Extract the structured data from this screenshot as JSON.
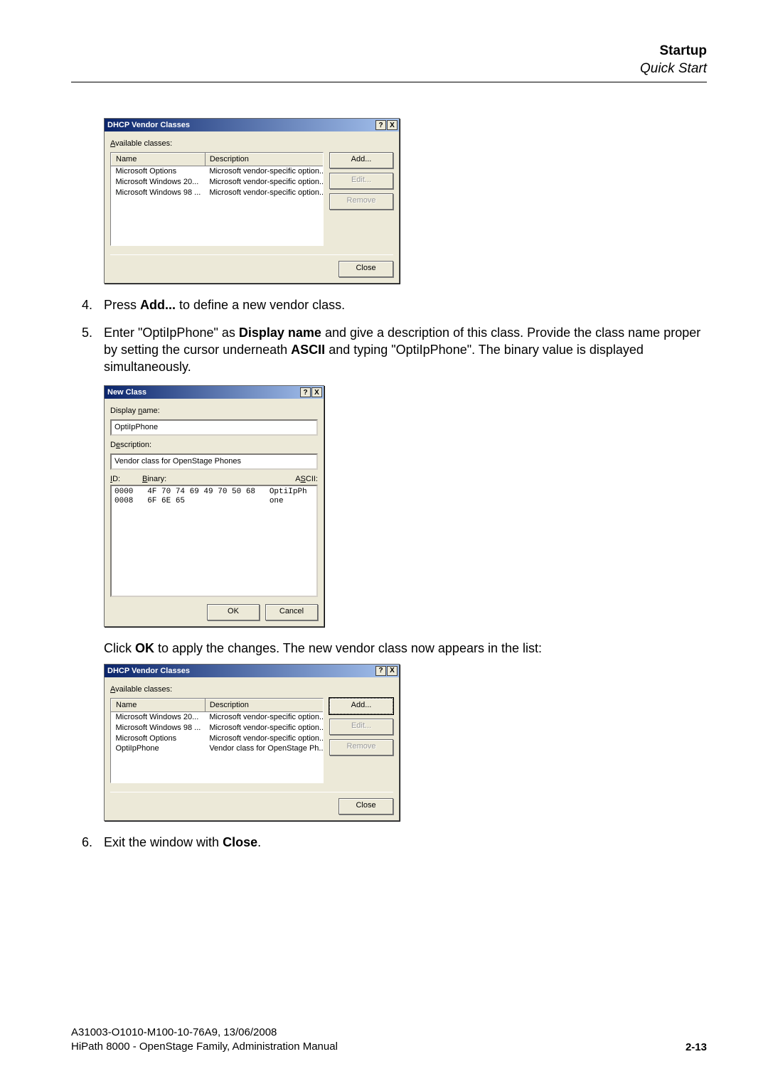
{
  "header": {
    "title": "Startup",
    "subtitle": "Quick Start"
  },
  "steps": {
    "s4_pre": "Press ",
    "s4_bold": "Add...",
    "s4_post": " to define a new vendor class.",
    "s5_a": "Enter \"OptiIpPhone\" as ",
    "s5_b": "Display name",
    "s5_c": " and give a description of this class. Provide the class name proper by setting the cursor underneath ",
    "s5_d": "ASCII",
    "s5_e": " and typing \"OptiIpPhone\". The binary value is displayed simultaneously.",
    "s5_post1": "Click ",
    "s5_post_b": "OK",
    "s5_post2": " to apply the changes. The new vendor class now appears in the list:",
    "s6_a": "Exit the window with ",
    "s6_b": "Close",
    "s6_c": "."
  },
  "dlg1": {
    "title": "DHCP Vendor Classes",
    "avail": "Available classes:",
    "col_name": "Name",
    "col_desc": "Description",
    "btn_add": "Add...",
    "btn_edit": "Edit...",
    "btn_remove": "Remove",
    "btn_close": "Close",
    "rows": [
      {
        "name": "Microsoft Options",
        "desc": "Microsoft vendor-specific option..."
      },
      {
        "name": "Microsoft Windows 20...",
        "desc": "Microsoft vendor-specific option..."
      },
      {
        "name": "Microsoft Windows 98 ...",
        "desc": "Microsoft vendor-specific option..."
      }
    ]
  },
  "dlg2": {
    "title": "New Class",
    "lbl_displayname": "Display name:",
    "val_displayname": "OptiIpPhone",
    "lbl_desc": "Description:",
    "val_desc": "Vendor class for OpenStage Phones",
    "lbl_id": "ID:",
    "lbl_binary": "Binary:",
    "lbl_ascii": "ASCII:",
    "hex": "0000   4F 70 74 69 49 70 50 68   OptiIpPh\n0008   6F 6E 65                  one",
    "btn_ok": "OK",
    "btn_cancel": "Cancel"
  },
  "dlg3": {
    "title": "DHCP Vendor Classes",
    "avail": "Available classes:",
    "col_name": "Name",
    "col_desc": "Description",
    "btn_add": "Add...",
    "btn_edit": "Edit...",
    "btn_remove": "Remove",
    "btn_close": "Close",
    "rows": [
      {
        "name": "Microsoft Windows 20...",
        "desc": "Microsoft vendor-specific option..."
      },
      {
        "name": "Microsoft Windows 98 ...",
        "desc": "Microsoft vendor-specific option..."
      },
      {
        "name": "Microsoft Options",
        "desc": "Microsoft vendor-specific option..."
      },
      {
        "name": "OptiIpPhone",
        "desc": "Vendor class for OpenStage Ph..."
      }
    ]
  },
  "footer": {
    "line1": "A31003-O1010-M100-10-76A9, 13/06/2008",
    "line2": "HiPath 8000 - OpenStage Family, Administration Manual",
    "pagenum": "2-13"
  },
  "icons": {
    "help": "?",
    "close": "X"
  }
}
